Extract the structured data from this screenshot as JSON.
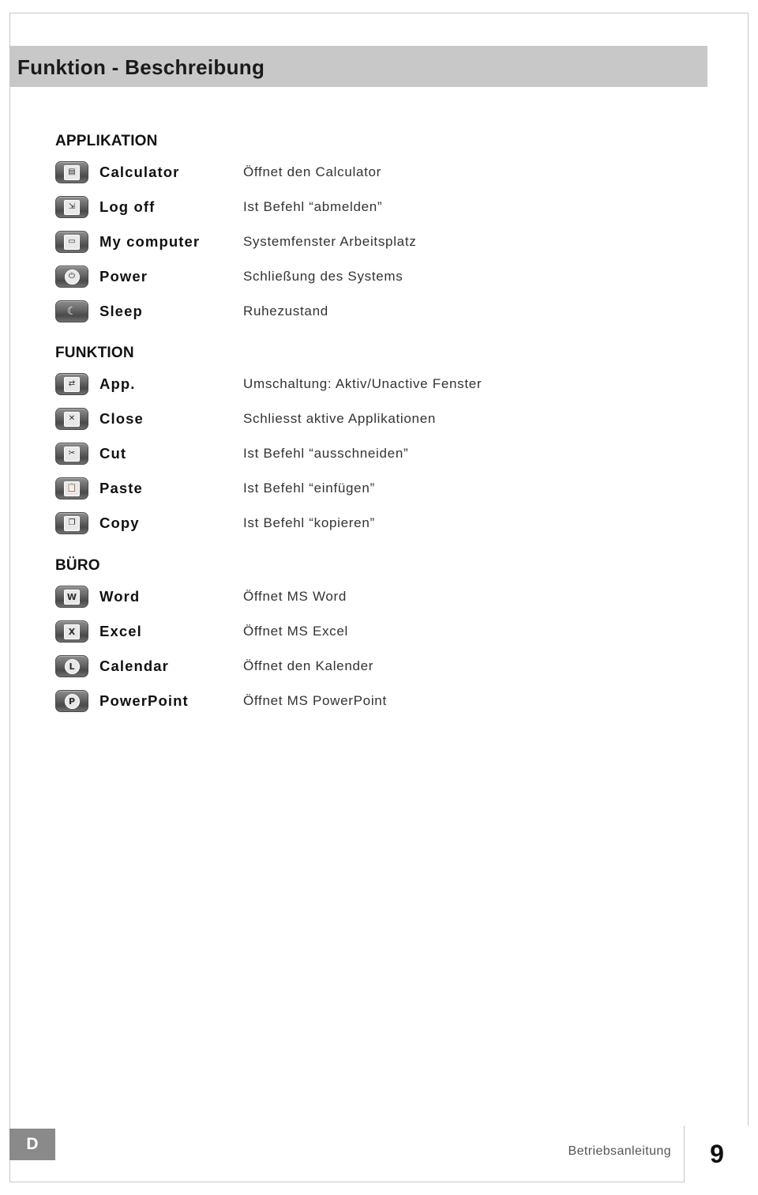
{
  "header": {
    "title": "Funktion - Beschreibung"
  },
  "sections": [
    {
      "title": "APPLIKATION",
      "rows": [
        {
          "icon": "calculator-icon",
          "glyph": "▤",
          "label": "Calculator",
          "desc": "Öffnet den Calculator"
        },
        {
          "icon": "logoff-icon",
          "glyph": "⇲",
          "label": "Log off",
          "desc": "Ist Befehl “abmelden”"
        },
        {
          "icon": "my-computer-icon",
          "glyph": "▭",
          "label": "My computer",
          "desc": "Systemfenster Arbeitsplatz"
        },
        {
          "icon": "power-icon",
          "glyph": "⏻",
          "label": "Power",
          "desc": "Schließung des Systems"
        },
        {
          "icon": "sleep-icon",
          "glyph": "☾",
          "label": "Sleep",
          "desc": "Ruhezustand"
        }
      ]
    },
    {
      "title": "FUNKTION",
      "rows": [
        {
          "icon": "app-switch-icon",
          "glyph": "⇄",
          "label": "App.",
          "desc": "Umschaltung: Aktiv/Unactive Fenster"
        },
        {
          "icon": "close-icon",
          "glyph": "✕",
          "label": "Close",
          "desc": "Schliesst aktive Applikationen"
        },
        {
          "icon": "cut-icon",
          "glyph": "✂",
          "label": "Cut",
          "desc": "Ist Befehl “ausschneiden”"
        },
        {
          "icon": "paste-icon",
          "glyph": "📋",
          "label": "Paste",
          "desc": "Ist Befehl “einfügen”"
        },
        {
          "icon": "copy-icon",
          "glyph": "❐",
          "label": "Copy",
          "desc": "Ist Befehl “kopieren”"
        }
      ]
    },
    {
      "title": "BÜRO",
      "rows": [
        {
          "icon": "word-icon",
          "glyph": "W",
          "label": "Word",
          "desc": "Öffnet MS Word"
        },
        {
          "icon": "excel-icon",
          "glyph": "X",
          "label": "Excel",
          "desc": "Öffnet MS Excel"
        },
        {
          "icon": "calendar-icon",
          "glyph": "L",
          "label": "Calendar",
          "desc": "Öffnet den Kalender"
        },
        {
          "icon": "powerpoint-icon",
          "glyph": "P",
          "label": "PowerPoint",
          "desc": "Öffnet MS PowerPoint"
        }
      ]
    }
  ],
  "footer": {
    "language_badge": "D",
    "manual_label": "Betriebsanleitung",
    "page_number": "9"
  }
}
